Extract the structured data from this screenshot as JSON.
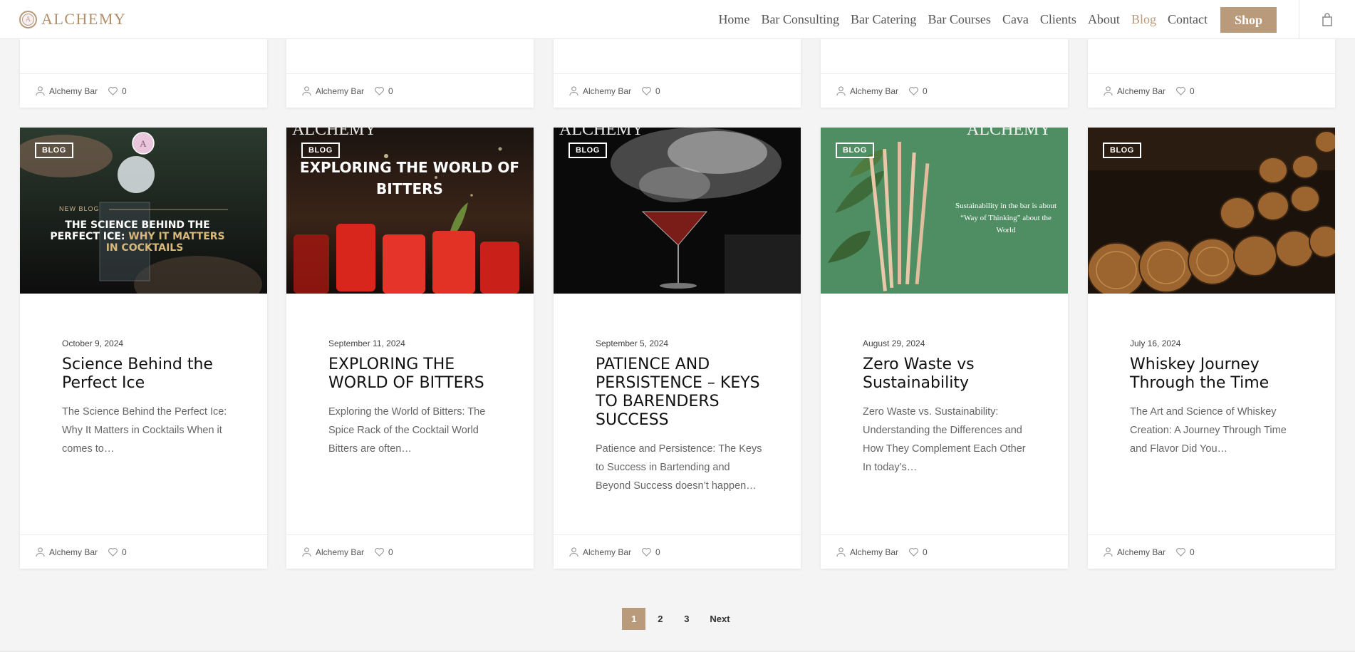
{
  "brand": {
    "name": "ALCHEMY",
    "mark_letter": "A"
  },
  "nav": {
    "items": [
      "Home",
      "Bar Consulting",
      "Bar Catering",
      "Bar Courses",
      "Cava",
      "Clients",
      "About",
      "Blog",
      "Contact"
    ],
    "active": "Blog",
    "shop_label": "Shop"
  },
  "icons": {
    "cart": "shopping-bag-icon",
    "author": "user-icon",
    "likes": "heart-icon"
  },
  "colors": {
    "accent": "#b99a7a",
    "logo": "#b38d67"
  },
  "top_row": [
    {
      "author": "Alchemy Bar",
      "likes": "0"
    },
    {
      "author": "Alchemy Bar",
      "likes": "0"
    },
    {
      "author": "Alchemy Bar",
      "likes": "0"
    },
    {
      "author": "Alchemy Bar",
      "likes": "0"
    },
    {
      "author": "Alchemy Bar",
      "likes": "0"
    }
  ],
  "posts": [
    {
      "category": "BLOG",
      "image_text": {
        "label": "NEW BLOG",
        "line1": "THE SCIENCE BEHIND THE",
        "line2a": "PERFECT ICE: ",
        "line2b": "WHY IT MATTERS",
        "line3": "IN COCKTAILS"
      },
      "date": "October 9, 2024",
      "title": "Science Behind the Perfect Ice",
      "excerpt": "The Science Behind the Perfect Ice: Why It Matters in Cocktails When it comes to…",
      "author": "Alchemy Bar",
      "likes": "0"
    },
    {
      "category": "BLOG",
      "image_text": {
        "brand": "ALCHEMY",
        "line1": "EXPLORING THE WORLD OF",
        "line2": "BITTERS"
      },
      "date": "September 11, 2024",
      "title": "EXPLORING THE WORLD OF BITTERS",
      "excerpt": "Exploring the World of Bitters: The Spice Rack of the Cocktail World Bitters are often…",
      "author": "Alchemy Bar",
      "likes": "0"
    },
    {
      "category": "BLOG",
      "image_text": {
        "brand": "ALCHEMY"
      },
      "date": "September 5, 2024",
      "title": "PATIENCE AND PERSISTENCE – KEYS TO BARENDERS SUCCESS",
      "excerpt": "Patience and Persistence: The Keys to Success in Bartending and Beyond   Success doesn’t happen…",
      "author": "Alchemy Bar",
      "likes": "0"
    },
    {
      "category": "BLOG",
      "image_text": {
        "brand": "ALCHEMY",
        "line1": "Sustainability in the bar is about",
        "line2": "“Way of Thinking” about the",
        "line3": "World"
      },
      "date": "August 29, 2024",
      "title": "Zero Waste vs Sustainability",
      "excerpt": "Zero Waste vs. Sustainability: Understanding the Differences and How They Complement Each Other In today’s…",
      "author": "Alchemy Bar",
      "likes": "0"
    },
    {
      "category": "BLOG",
      "image_text": {},
      "date": "July 16, 2024",
      "title": "Whiskey Journey Through the Time",
      "excerpt": "The Art and Science of Whiskey Creation: A Journey Through Time and Flavor Did You…",
      "author": "Alchemy Bar",
      "likes": "0"
    }
  ],
  "pagination": {
    "pages": [
      "1",
      "2",
      "3"
    ],
    "current": "1",
    "next_label": "Next"
  }
}
